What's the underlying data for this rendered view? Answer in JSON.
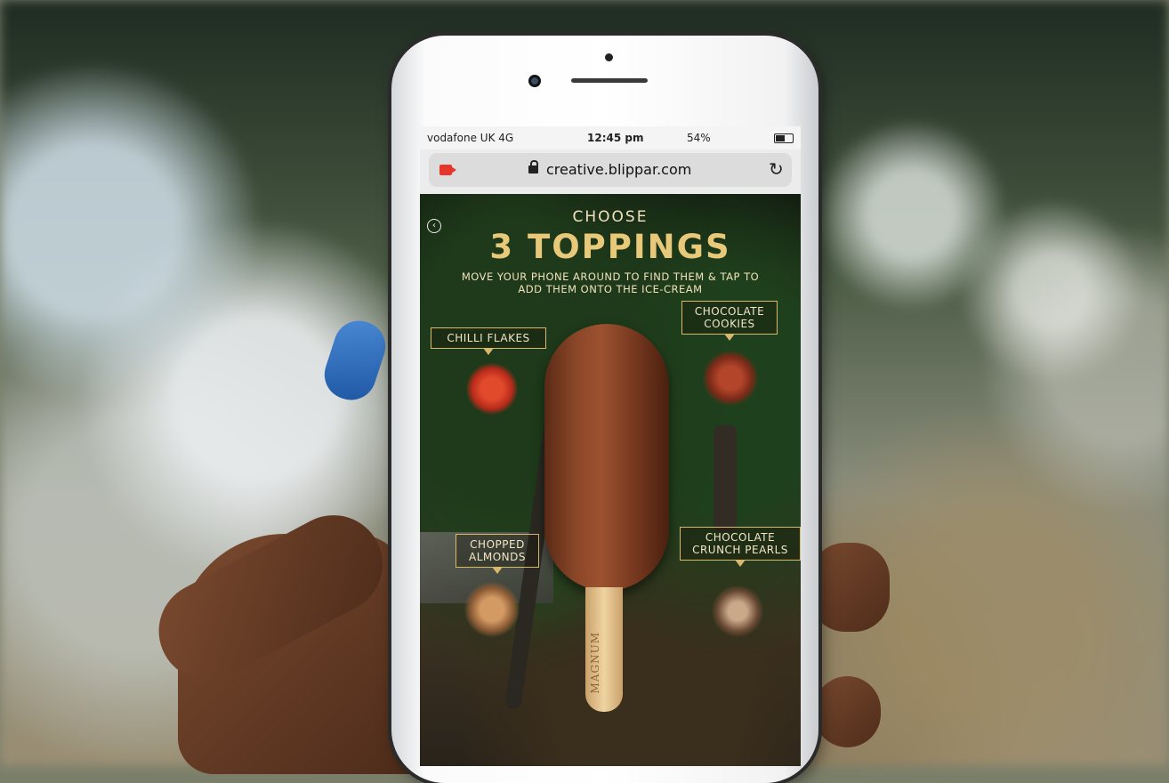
{
  "status_bar": {
    "carrier": "vodafone UK  4G",
    "time": "12:45 pm",
    "battery": "54%"
  },
  "browser": {
    "url": "creative.blippar.com",
    "icons": [
      "record-icon",
      "lock-icon",
      "reload-icon"
    ]
  },
  "ar_page": {
    "heading_small": "CHOOSE",
    "heading_large": "3 TOPPINGS",
    "instructions": "MOVE YOUR PHONE AROUND TO FIND THEM & TAP TO ADD THEM ONTO THE ICE-CREAM",
    "toppings": [
      {
        "label": "CHILLI FLAKES"
      },
      {
        "label": "CHOCOLATE COOKIES"
      },
      {
        "label": "CHOPPED ALMONDS"
      },
      {
        "label": "CHOCOLATE CRUNCH PEARLS"
      }
    ],
    "stick_brand": "MAGNUM"
  },
  "colors": {
    "gold": "#e8c97a",
    "nail": "#2a6ac0"
  }
}
